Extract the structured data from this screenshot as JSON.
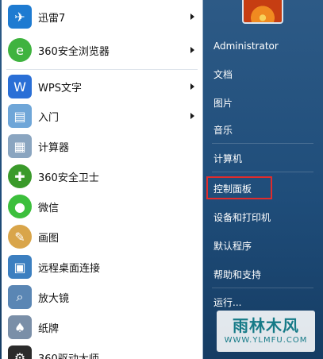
{
  "programs": [
    {
      "label": "迅雷7",
      "icon": "thunder-bird-icon",
      "color": "#1e7bd1",
      "arrow": true
    },
    {
      "label": "360安全浏览器",
      "icon": "browser-icon",
      "color": "#3fb33f",
      "arrow": true
    },
    {
      "label": "WPS文字",
      "icon": "wps-w-icon",
      "color": "#2a6fd6",
      "arrow": true
    },
    {
      "label": "入门",
      "icon": "getting-started-icon",
      "color": "#6fa6d8",
      "arrow": true
    },
    {
      "label": "计算器",
      "icon": "calculator-icon",
      "color": "#8aa5c0",
      "arrow": false
    },
    {
      "label": "360安全卫士",
      "icon": "shield-plus-icon",
      "color": "#3a9a2a",
      "arrow": false
    },
    {
      "label": "微信",
      "icon": "wechat-icon",
      "color": "#3cbf3c",
      "arrow": false
    },
    {
      "label": "画图",
      "icon": "paint-palette-icon",
      "color": "#d9a54a",
      "arrow": false
    },
    {
      "label": "远程桌面连接",
      "icon": "remote-desktop-icon",
      "color": "#3c7fc0",
      "arrow": false
    },
    {
      "label": "放大镜",
      "icon": "magnifier-icon",
      "color": "#5a86b4",
      "arrow": false
    },
    {
      "label": "纸牌",
      "icon": "cards-icon",
      "color": "#7a8fa8",
      "arrow": false
    },
    {
      "label": "360驱动大师",
      "icon": "driver-gear-icon",
      "color": "#2b2b2b",
      "arrow": false
    }
  ],
  "right_panel": {
    "user": "Administrator",
    "documents": "文档",
    "pictures": "图片",
    "music": "音乐",
    "computer": "计算机",
    "control_panel": "控制面板",
    "devices_printers": "设备和打印机",
    "default_programs": "默认程序",
    "help_support": "帮助和支持",
    "run": "运行..."
  },
  "watermark": {
    "title": "雨林木风",
    "url": "WWW.YLMFU.COM"
  },
  "colors": {
    "highlight": "#e02c2c",
    "panel": "#1f4d7a"
  }
}
